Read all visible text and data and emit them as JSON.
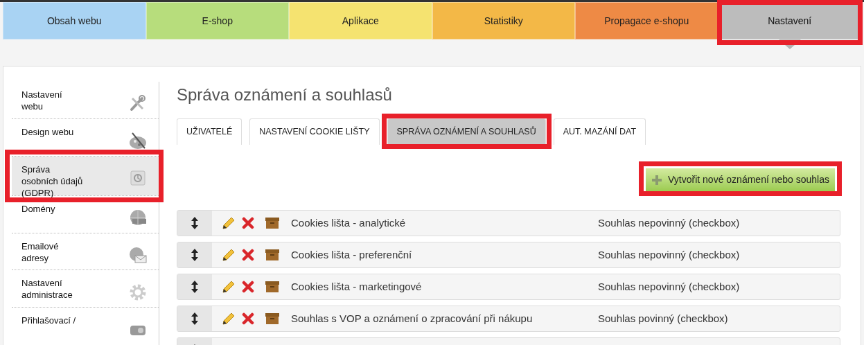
{
  "main_tabs": [
    {
      "label": "Obsah webu",
      "color": "#a9d3f3",
      "selected": false,
      "highlighted": false
    },
    {
      "label": "E-shop",
      "color": "#b7dd7c",
      "selected": false,
      "highlighted": false
    },
    {
      "label": "Aplikace",
      "color": "#f5e370",
      "selected": false,
      "highlighted": false
    },
    {
      "label": "Statistiky",
      "color": "#f3b847",
      "selected": false,
      "highlighted": false
    },
    {
      "label": "Propagace e-shopu",
      "color": "#ee8a45",
      "selected": false,
      "highlighted": false
    },
    {
      "label": "Nastavení",
      "color": "#bcbcbc",
      "selected": true,
      "highlighted": true
    }
  ],
  "sidebar": {
    "items": [
      {
        "label": "Nastavení webu",
        "selected": false,
        "highlighted": false
      },
      {
        "label": "Design webu",
        "selected": false,
        "highlighted": false
      },
      {
        "label": "Správa osobních údajů (GDPR)",
        "selected": true,
        "highlighted": true
      },
      {
        "label": "Domény",
        "selected": false,
        "highlighted": false
      },
      {
        "label": "Emailové adresy",
        "selected": false,
        "highlighted": false
      },
      {
        "label": "Nastavení administrace",
        "selected": false,
        "highlighted": false
      },
      {
        "label": "Přihlašovací /",
        "selected": false,
        "highlighted": false
      }
    ]
  },
  "page_title": "Správa oznámení a souhlasů",
  "sub_tabs": [
    {
      "label": "UŽIVATELÉ",
      "selected": false,
      "highlighted": false
    },
    {
      "label": "NASTAVENÍ COOKIE LIŠTY",
      "selected": false,
      "highlighted": false
    },
    {
      "label": "SPRÁVA OZNÁMENÍ A SOUHLASŮ",
      "selected": true,
      "highlighted": true
    },
    {
      "label": "AUT. MAZÁNÍ DAT",
      "selected": false,
      "highlighted": false
    }
  ],
  "create_button": {
    "label": "Vytvořit nové oznámení nebo souhlas",
    "highlighted": true
  },
  "rows": [
    {
      "kind": "item",
      "title": "Cookies lišta - analytické",
      "type": "Souhlas nepovinný (checkbox)"
    },
    {
      "kind": "item",
      "title": "Cookies lišta - preferenční",
      "type": "Souhlas nepovinný (checkbox)"
    },
    {
      "kind": "item",
      "title": "Cookies lišta - marketingové",
      "type": "Souhlas nepovinný (checkbox)"
    },
    {
      "kind": "item",
      "title": "Souhlas s VOP a oznámení o zpracování při nákupu",
      "type": "Souhlas povinný (checkbox)"
    },
    {
      "kind": "blank"
    }
  ]
}
